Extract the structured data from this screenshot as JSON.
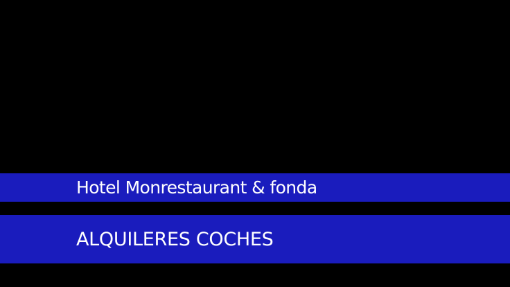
{
  "theme": {
    "background": "#000000",
    "banner_color": "#1a1cbd",
    "text_color": "#ffffff"
  },
  "top_banner": {
    "text": "Hotel Monrestaurant & fonda"
  },
  "bottom_banner": {
    "text": "ALQUILERES COCHES"
  }
}
